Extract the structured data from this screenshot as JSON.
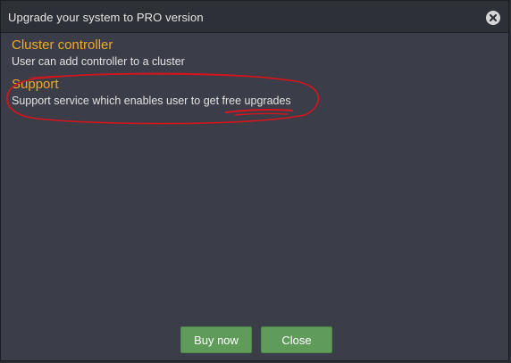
{
  "dialog": {
    "title": "Upgrade your system to PRO version",
    "close_icon": "close-circle-icon"
  },
  "features": [
    {
      "name": "Cluster controller",
      "description": "User can add controller to a cluster"
    },
    {
      "name": "Support",
      "description": "Support service which enables user to get free upgrades"
    }
  ],
  "buttons": {
    "buy_label": "Buy now",
    "close_label": "Close"
  },
  "colors": {
    "feature_title": "#f0a92a",
    "button_green": "#5f9c5a",
    "annotation_red": "#d8141c"
  }
}
